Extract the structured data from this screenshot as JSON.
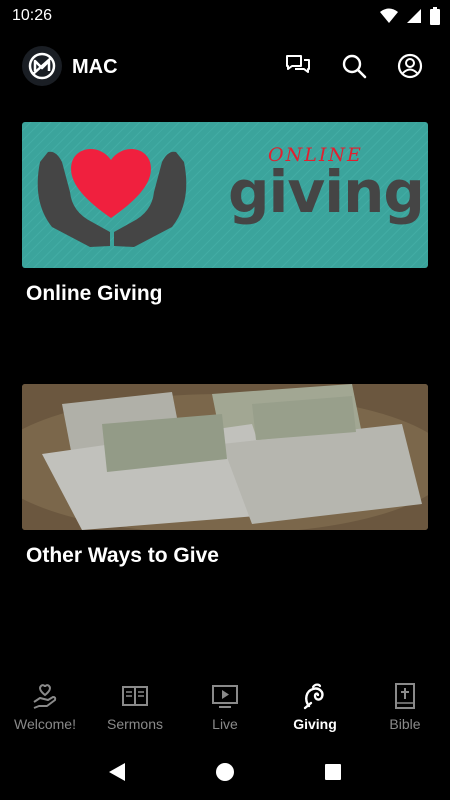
{
  "status": {
    "time": "10:26"
  },
  "app": {
    "title": "MAC"
  },
  "cards": [
    {
      "title": "Online Giving",
      "banner_small": "ONLINE",
      "banner_big": "giving"
    },
    {
      "title": "Other Ways to Give"
    }
  ],
  "nav": {
    "items": [
      {
        "label": "Welcome!",
        "icon": "hand-heart-icon"
      },
      {
        "label": "Sermons",
        "icon": "book-icon"
      },
      {
        "label": "Live",
        "icon": "tv-play-icon"
      },
      {
        "label": "Giving",
        "icon": "giving-icon"
      },
      {
        "label": "Bible",
        "icon": "bible-cross-icon"
      }
    ],
    "active_index": 3
  },
  "colors": {
    "banner_teal": "#3ba49c",
    "heart_red": "#f0203e",
    "banner_gray": "#454545",
    "banner_script": "#e02030",
    "inactive_nav": "#8a8a8a"
  }
}
